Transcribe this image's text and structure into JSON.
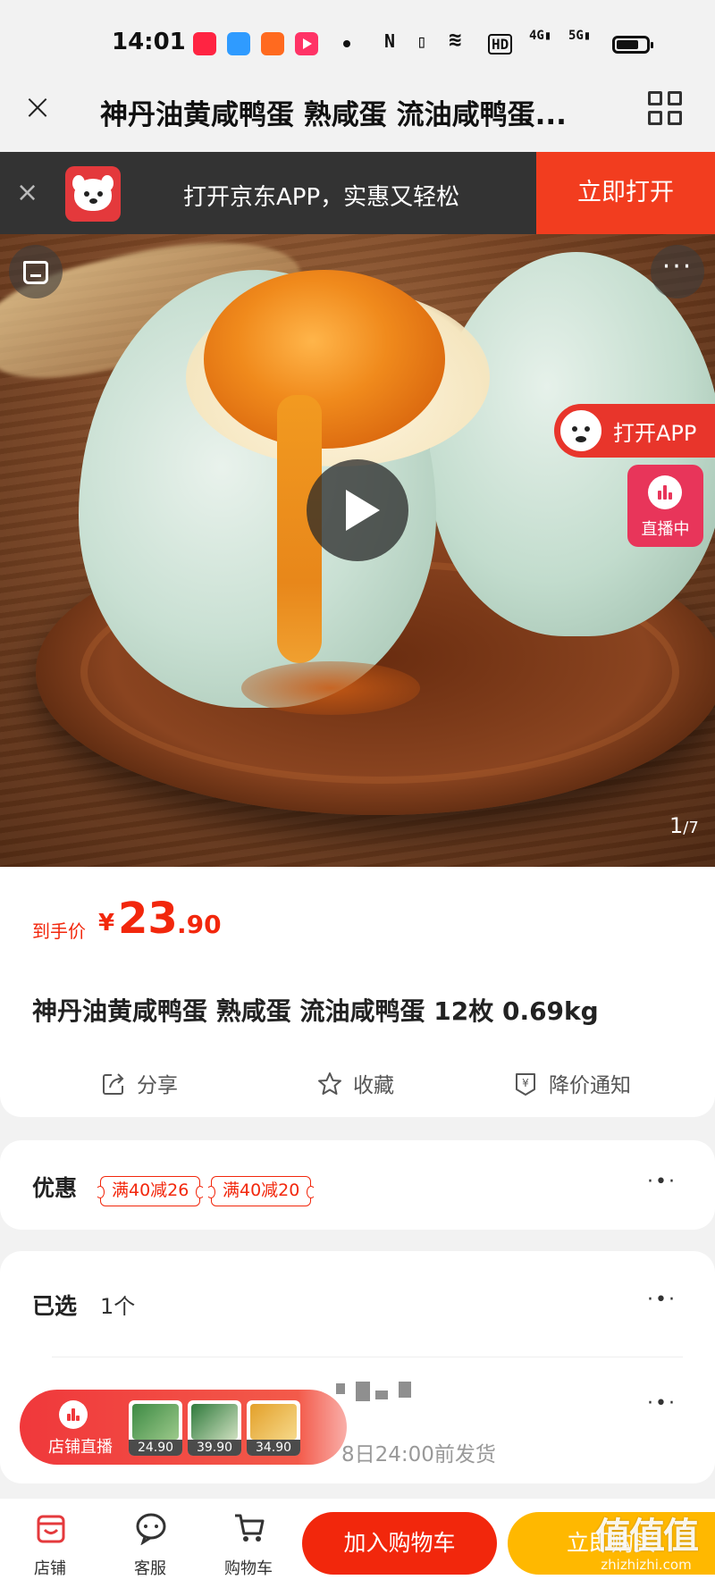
{
  "status": {
    "time": "14:01",
    "app_icons": [
      {
        "name": "xiaohongshu-app-icon",
        "color": "#ff2442",
        "label": "小红书"
      },
      {
        "name": "blue-app-icon",
        "color": "#2f9bff"
      },
      {
        "name": "orange-app-icon",
        "color": "#ff6a1f"
      },
      {
        "name": "video-app-icon",
        "color": "#ff3366"
      }
    ],
    "indicators": [
      "NFC",
      "vibrate",
      "wifi",
      "HD",
      "4G",
      "5G"
    ]
  },
  "titlebar": {
    "title": "神丹油黄咸鸭蛋 熟咸蛋 流油咸鸭蛋..."
  },
  "banner": {
    "text": "打开京东APP，实惠又轻松",
    "button": "立即打开"
  },
  "hero": {
    "open_app": "打开APP",
    "live": "直播中",
    "counter_current": "1",
    "counter_total": "/7"
  },
  "price": {
    "label": "到手价",
    "currency": "¥",
    "integer": "23",
    "decimal": ".90"
  },
  "product": {
    "name": "神丹油黄咸鸭蛋 熟咸蛋 流油咸鸭蛋 12枚 0.69kg"
  },
  "actions": {
    "share": "分享",
    "favorite": "收藏",
    "price_alert": "降价通知"
  },
  "offers": {
    "label": "优惠",
    "coupons": [
      "满40减26",
      "满40减20"
    ]
  },
  "selected": {
    "label": "已选",
    "value": "1个"
  },
  "delivery": {
    "ship_date": "8日24:00前发货"
  },
  "live_pill": {
    "label": "店铺直播",
    "thumbs": [
      {
        "price": "24.90",
        "color": "#3d8a44"
      },
      {
        "price": "39.90",
        "color": "#2f7a3c"
      },
      {
        "price": "34.90",
        "color": "#e3a02a"
      }
    ]
  },
  "bottom_nav": {
    "shop": "店铺",
    "service": "客服",
    "cart": "购物车",
    "add_to_cart": "加入购物车",
    "buy_now": "立即购买"
  },
  "watermark": {
    "big": "值值值",
    "small": "zhizhizhi.com"
  },
  "colors": {
    "jd_red": "#f2270c",
    "buy_yellow": "#ffb800",
    "banner_dark": "#333333",
    "live_pink": "#e8355a"
  }
}
